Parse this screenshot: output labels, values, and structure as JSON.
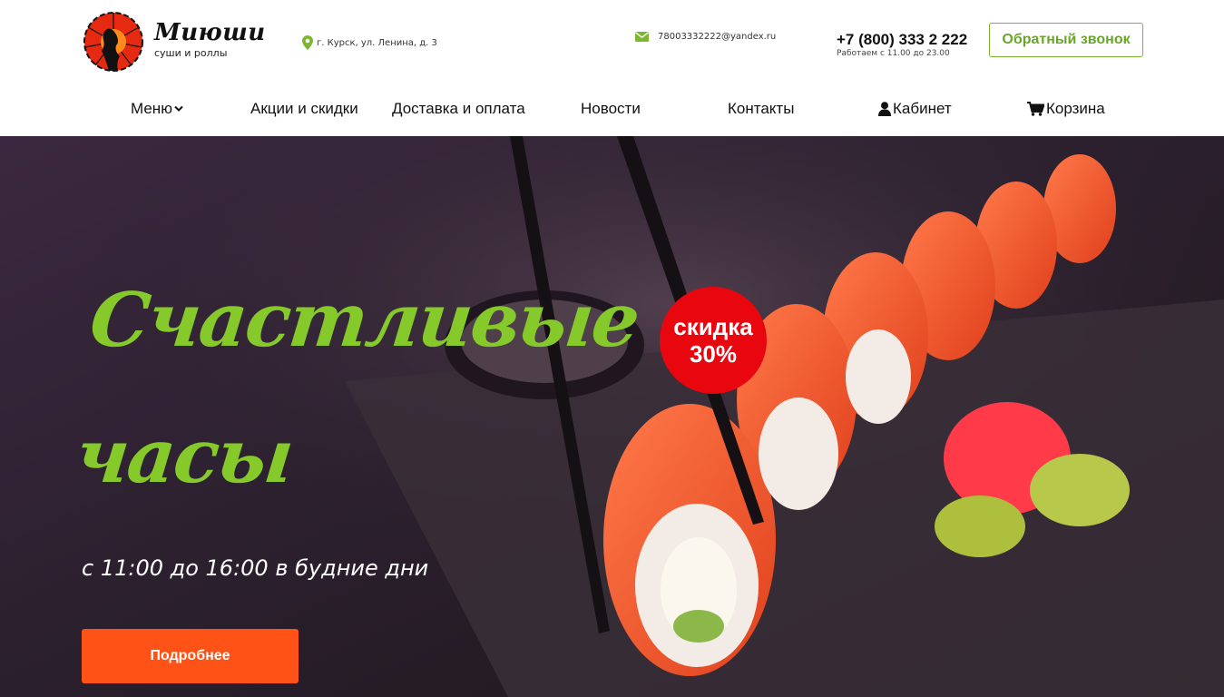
{
  "brand": {
    "name": "Миюши",
    "tagline": "суши и роллы"
  },
  "contacts": {
    "address": "г. Курск, ул. Ленина, д. 3",
    "email": "78003332222@yandex.ru",
    "phone": "+7 (800) 333 2 222",
    "hours": "Работаем с 11.00 до 23.00",
    "callback_label": "Обратный звонок"
  },
  "nav": {
    "menu": "Меню",
    "promo": "Акции и скидки",
    "delivery": "Доставка и оплата",
    "news": "Новости",
    "contacts": "Контакты",
    "account": "Кабинет",
    "cart": "Корзина"
  },
  "hero": {
    "title_line1": "Счастливые",
    "title_line2": "часы",
    "subtitle": "с 11:00 до 16:00 в будние дни",
    "button_label": "Подробнее",
    "badge_line1": "скидка",
    "badge_line2": "30%"
  },
  "colors": {
    "accent_green": "#85c92a",
    "button_orange": "#ff5216",
    "badge_red": "#e8060f",
    "logo_red": "#e62a12"
  },
  "icons": {
    "address": "map-pin-icon",
    "email": "envelope-icon",
    "menu_dropdown": "chevron-down-icon",
    "account": "user-icon",
    "cart": "cart-icon"
  }
}
